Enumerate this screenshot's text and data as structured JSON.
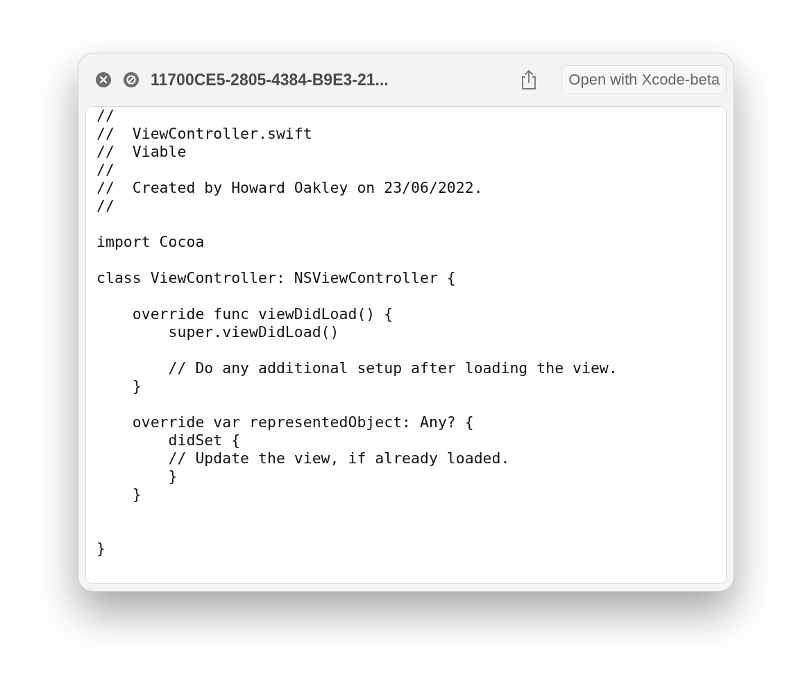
{
  "window": {
    "title": "11700CE5-2805-4384-B9E3-21..."
  },
  "toolbar": {
    "open_button": "Open with Xcode-beta"
  },
  "code_lines": [
    {
      "kind": "text",
      "text": "//"
    },
    {
      "kind": "text",
      "text": "//  ViewController.swift"
    },
    {
      "kind": "text",
      "text": "//  Viable"
    },
    {
      "kind": "text",
      "text": "//"
    },
    {
      "kind": "text",
      "text": "//  Created by Howard Oakley on 23/06/2022."
    },
    {
      "kind": "text",
      "text": "//"
    },
    {
      "kind": "blank"
    },
    {
      "kind": "text",
      "text": "import Cocoa"
    },
    {
      "kind": "blank"
    },
    {
      "kind": "text",
      "text": "class ViewController: NSViewController {"
    },
    {
      "kind": "blank"
    },
    {
      "kind": "text",
      "text": "    override func viewDidLoad() {"
    },
    {
      "kind": "text",
      "text": "        super.viewDidLoad()"
    },
    {
      "kind": "blank"
    },
    {
      "kind": "text",
      "text": "        // Do any additional setup after loading the view."
    },
    {
      "kind": "text",
      "text": "    }"
    },
    {
      "kind": "blank"
    },
    {
      "kind": "text",
      "text": "    override var representedObject: Any? {"
    },
    {
      "kind": "text",
      "text": "        didSet {"
    },
    {
      "kind": "text",
      "text": "        // Update the view, if already loaded."
    },
    {
      "kind": "text",
      "text": "        }"
    },
    {
      "kind": "text",
      "text": "    }"
    },
    {
      "kind": "blank"
    },
    {
      "kind": "blank"
    },
    {
      "kind": "text",
      "text": "}"
    }
  ]
}
